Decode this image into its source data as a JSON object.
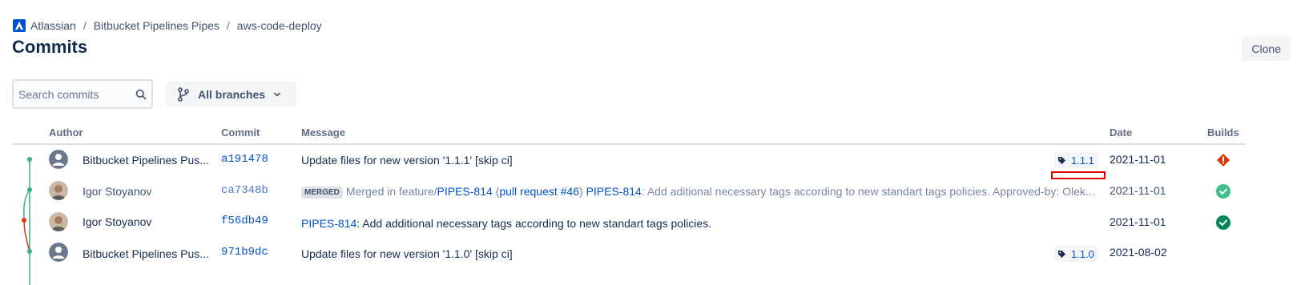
{
  "breadcrumb": {
    "items": [
      {
        "label": "Atlassian",
        "icon": "atlassian-logo"
      },
      {
        "label": "Bitbucket Pipelines Pipes"
      },
      {
        "label": "aws-code-deploy"
      }
    ],
    "separator": "/"
  },
  "page": {
    "title": "Commits"
  },
  "toolbar": {
    "clone_label": "Clone",
    "search_placeholder": "Search commits",
    "search_value": "",
    "branch_filter_label": "All branches"
  },
  "table": {
    "headers": {
      "author": "Author",
      "commit": "Commit",
      "message": "Message",
      "date": "Date",
      "builds": "Builds"
    },
    "rows": [
      {
        "author": "Bitbucket Pipelines Pus...",
        "avatar": "default-user-avatar",
        "hash": "a191478",
        "message": "Update files for new version '1.1.1' [skip ci]",
        "tag": "1.1.1",
        "date": "2021-11-01",
        "build_status": "failed",
        "build_color": "#de350b"
      },
      {
        "author": "Igor Stoyanov",
        "avatar": "user-photo-avatar",
        "hash": "ca7348b",
        "merged_label": "MERGED",
        "message_parts": [
          {
            "text": "Merged in feature/"
          },
          {
            "text": "PIPES-814",
            "link": true
          },
          {
            "text": " ("
          },
          {
            "text": "pull request #46",
            "link": true
          },
          {
            "text": ") "
          },
          {
            "text": "PIPES-814",
            "link": true
          },
          {
            "text": ": Add aditional necessary tags according to new standart tags policies. Approved-by: Olek..."
          }
        ],
        "date": "2021-11-01",
        "build_status": "successful",
        "build_color": "#36b37e"
      },
      {
        "author": "Igor Stoyanov",
        "avatar": "user-photo-avatar",
        "hash": "f56db49",
        "message_parts": [
          {
            "text": "PIPES-814",
            "link": true
          },
          {
            "text": ": Add additional necessary tags according to new standart tags policies."
          }
        ],
        "date": "2021-11-01",
        "build_status": "successful",
        "build_color": "#00875a"
      },
      {
        "author": "Bitbucket Pipelines Pus...",
        "avatar": "default-user-avatar",
        "hash": "971b9dc",
        "message": "Update files for new version '1.1.0' [skip ci]",
        "tag": "1.1.0",
        "date": "2021-08-02"
      }
    ]
  },
  "colors": {
    "graph_main": "#36b37e",
    "graph_branch": "#de350b",
    "link": "#0052cc",
    "highlight": "#e30000"
  }
}
